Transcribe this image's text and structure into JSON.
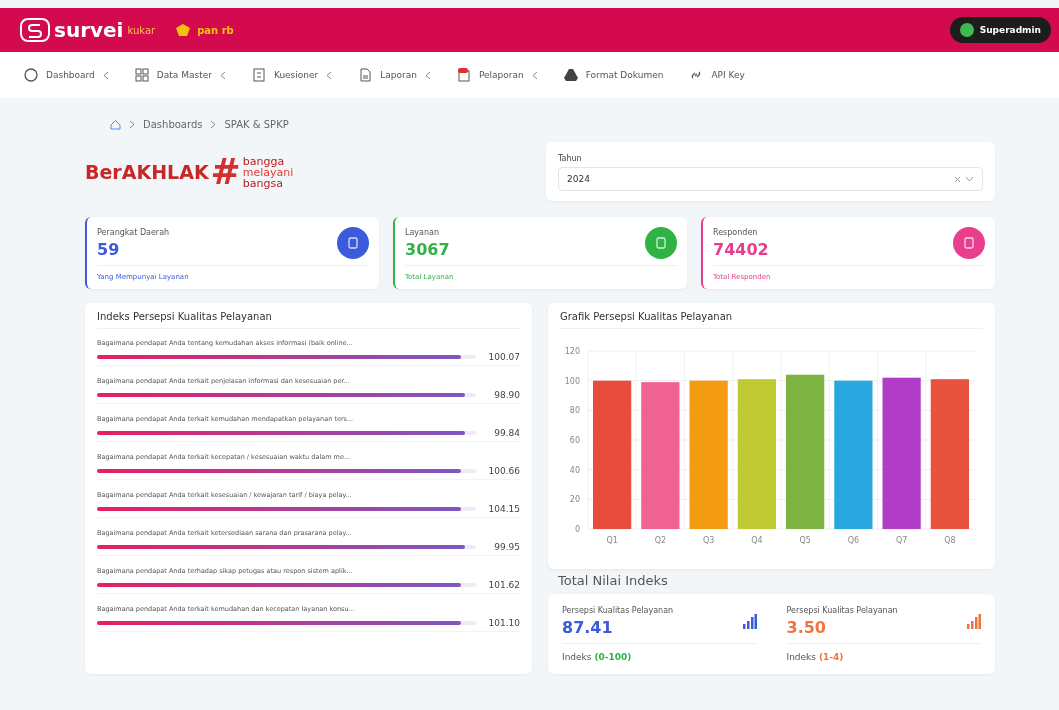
{
  "header": {
    "brand": "survei",
    "brand_suffix": "kukar",
    "partner_logo": "pan rb",
    "user": "Superadmin"
  },
  "nav": [
    {
      "label": "Dashboard",
      "submenu": true
    },
    {
      "label": "Data Master",
      "submenu": true
    },
    {
      "label": "Kuesioner",
      "submenu": true
    },
    {
      "label": "Laporan",
      "submenu": true
    },
    {
      "label": "Pelaporan",
      "submenu": true
    },
    {
      "label": "Format Dokumen",
      "submenu": false
    },
    {
      "label": "API Key",
      "submenu": false
    }
  ],
  "breadcrumb": [
    "Dashboards",
    "SPAK & SPKP"
  ],
  "banner": {
    "word": "BerAKHLAK",
    "symbol": "#",
    "tagline": [
      "bangga",
      "melayani",
      "bangsa"
    ]
  },
  "year_filter": {
    "label": "Tahun",
    "value": "2024"
  },
  "stats": [
    {
      "title": "Perangkat Daerah",
      "value": "59",
      "footer": "Yang Mempunyai Layanan",
      "color": "#3b5bdb"
    },
    {
      "title": "Layanan",
      "value": "3067",
      "footer": "Total Layanan",
      "color": "#2fb344"
    },
    {
      "title": "Responden",
      "value": "74402",
      "footer": "Total Responden",
      "color": "#e83e8c"
    }
  ],
  "index_panel": {
    "title": "Indeks Persepsi Kualitas Pelayanan",
    "items": [
      {
        "question": "Bagaimana pendapat Anda tentang kemudahan akses informasi (baik online...",
        "value": "100.07",
        "level": 0.96
      },
      {
        "question": "Bagaimana pendapat Anda terkait penjelasan informasi dan kesesuaian per...",
        "value": "98.90",
        "level": 0.97
      },
      {
        "question": "Bagaimana pendapat Anda terkait kemudahan mendapatkan pelayanan ters...",
        "value": "99.84",
        "level": 0.97
      },
      {
        "question": "Bagaimana pendapat Anda terkait kecepatan / kesesuaian waktu dalam me...",
        "value": "100.66",
        "level": 0.96
      },
      {
        "question": "Bagaimana pendapat Anda terkait kesesuaian / kewajaran tarif / biaya pelay...",
        "value": "104.15",
        "level": 0.96
      },
      {
        "question": "Bagaimana pendapat Anda terkait ketersediaan sarana dan prasarana pelay...",
        "value": "99.95",
        "level": 0.97
      },
      {
        "question": "Bagaimana pendapat Anda terhadap sikap petugas atau respon sistem aplik...",
        "value": "101.62",
        "level": 0.96
      },
      {
        "question": "Bagaimana pendapat Anda terkait kemudahan dan kecepatan layanan konsu...",
        "value": "101.10",
        "level": 0.96
      }
    ]
  },
  "chart_panel": {
    "title": "Grafik Persepsi Kualitas Pelayanan",
    "chart_data": {
      "type": "bar",
      "categories": [
        "Q1",
        "Q2",
        "Q3",
        "Q4",
        "Q5",
        "Q6",
        "Q7",
        "Q8"
      ],
      "series": [
        {
          "values": [
            100,
            99,
            100,
            101,
            104,
            100,
            102,
            101
          ]
        }
      ],
      "grid": true,
      "colors": [
        "#e74c3c",
        "#f06292",
        "#f39c12",
        "#c0ca33",
        "#7cb342",
        "#29a8e0",
        "#b03cc8",
        "#e8533f"
      ],
      "ylim": [
        0,
        120
      ],
      "yticks": [
        0,
        20,
        40,
        60,
        80,
        100,
        120
      ]
    }
  },
  "totals": {
    "title": "Total Nilai Indeks",
    "items": [
      {
        "label": "Persepsi Kualitas Pelayanan",
        "value": "87.41",
        "note": "Indeks",
        "range": {
          "text": "(0-100)",
          "color": "#2fb344"
        },
        "color": "#3b5bdb"
      },
      {
        "label": "Persepsi Kualitas Pelayanan",
        "value": "3.50",
        "note": "Indeks",
        "range": {
          "text": "(1-4)",
          "color": "#f0743e"
        },
        "color": "#f0743e"
      }
    ]
  }
}
